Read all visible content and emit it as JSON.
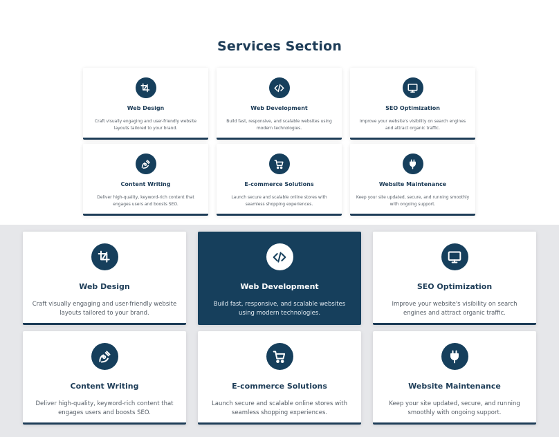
{
  "section": {
    "title": "Services Section"
  },
  "services": [
    {
      "title": "Web Design",
      "description": "Craft visually engaging and user-friendly website layouts tailored to your brand.",
      "icon": "crop-icon"
    },
    {
      "title": "Web Development",
      "description": "Build fast, responsive, and scalable websites using modern technologies.",
      "icon": "code-icon"
    },
    {
      "title": "SEO Optimization",
      "description": "Improve your website's visibility on search engines and attract organic traffic.",
      "icon": "monitor-icon"
    },
    {
      "title": "Content Writing",
      "description": "Deliver high-quality, keyword-rich content that engages users and boosts SEO.",
      "icon": "pen-nib-icon"
    },
    {
      "title": "E-commerce Solutions",
      "description": "Launch secure and scalable online stores with seamless shopping experiences.",
      "icon": "shopping-cart-icon"
    },
    {
      "title": "Website Maintenance",
      "description": "Keep your site updated, secure, and running smoothly with ongoing support.",
      "icon": "plug-icon"
    }
  ],
  "colors": {
    "primary": "#1d3c57",
    "active_card": "#163f5c",
    "background": "#e6e7ea"
  }
}
